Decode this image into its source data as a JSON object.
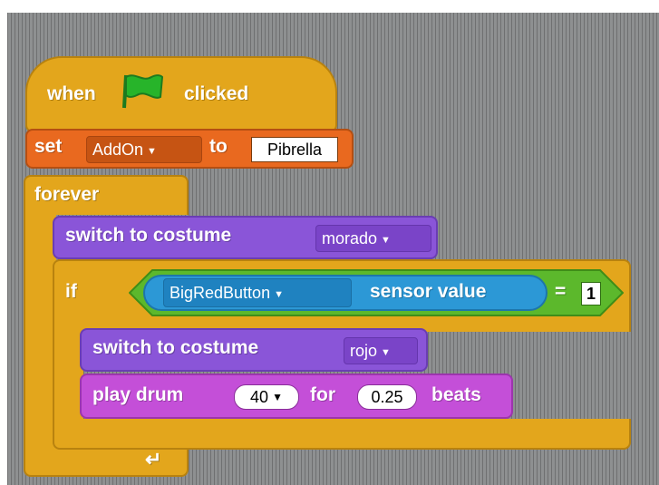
{
  "script": {
    "hat": {
      "before": "when",
      "after": "clicked",
      "icon": "green-flag-icon"
    },
    "set_block": {
      "label": "set",
      "variable": "AddOn",
      "to_label": "to",
      "value": "Pibrella"
    },
    "forever_block": {
      "label": "forever",
      "loop_icon": "loop-arrow-icon"
    },
    "costume_block_1": {
      "label": "switch to costume",
      "costume": "morado"
    },
    "if_block": {
      "label": "if",
      "sensor": "BigRedButton",
      "sensor_label": "sensor value",
      "operator": "=",
      "compare_value": "1"
    },
    "costume_block_2": {
      "label": "switch to costume",
      "costume": "rojo"
    },
    "drum_block": {
      "label": "play drum",
      "drum": "40",
      "for_label": "for",
      "beats": "0.25",
      "beats_label": "beats"
    }
  },
  "colors": {
    "control": "#e3a61c",
    "variables": "#e9691f",
    "looks": "#8a55d8",
    "sound": "#c44fd8",
    "operators": "#5cb82c",
    "sensing": "#2c98d6",
    "flag": "#27b42a"
  }
}
